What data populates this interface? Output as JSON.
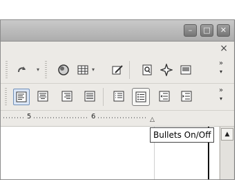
{
  "window": {
    "controls": {
      "minimize": "–",
      "maximize": "□",
      "close": "✕"
    }
  },
  "menubar": {
    "close_glyph": "×"
  },
  "toolbar1": {
    "buttons": [
      {
        "name": "redo-icon"
      },
      {
        "name": "navigator-icon"
      },
      {
        "name": "table-icon"
      },
      {
        "name": "show-draw-functions-icon"
      },
      {
        "name": "page-preview-icon"
      },
      {
        "name": "navigator-star-icon"
      },
      {
        "name": "gallery-icon"
      }
    ],
    "overflow_glyph": "»"
  },
  "toolbar2": {
    "buttons": [
      {
        "name": "align-left-icon",
        "pressed": true
      },
      {
        "name": "align-center-icon"
      },
      {
        "name": "align-right-icon"
      },
      {
        "name": "justify-icon"
      },
      {
        "name": "numbering-icon"
      },
      {
        "name": "bullets-icon",
        "hovered": true
      },
      {
        "name": "decrease-indent-icon"
      },
      {
        "name": "increase-indent-icon"
      }
    ],
    "overflow_glyph": "»"
  },
  "ruler": {
    "labels": [
      "5",
      "6"
    ]
  },
  "scrollbar": {
    "up_glyph": "▲"
  },
  "tooltip": {
    "text": "Bullets On/Off"
  },
  "colors": {
    "accent": "#6f8fb8",
    "chrome": "#eceae6"
  }
}
